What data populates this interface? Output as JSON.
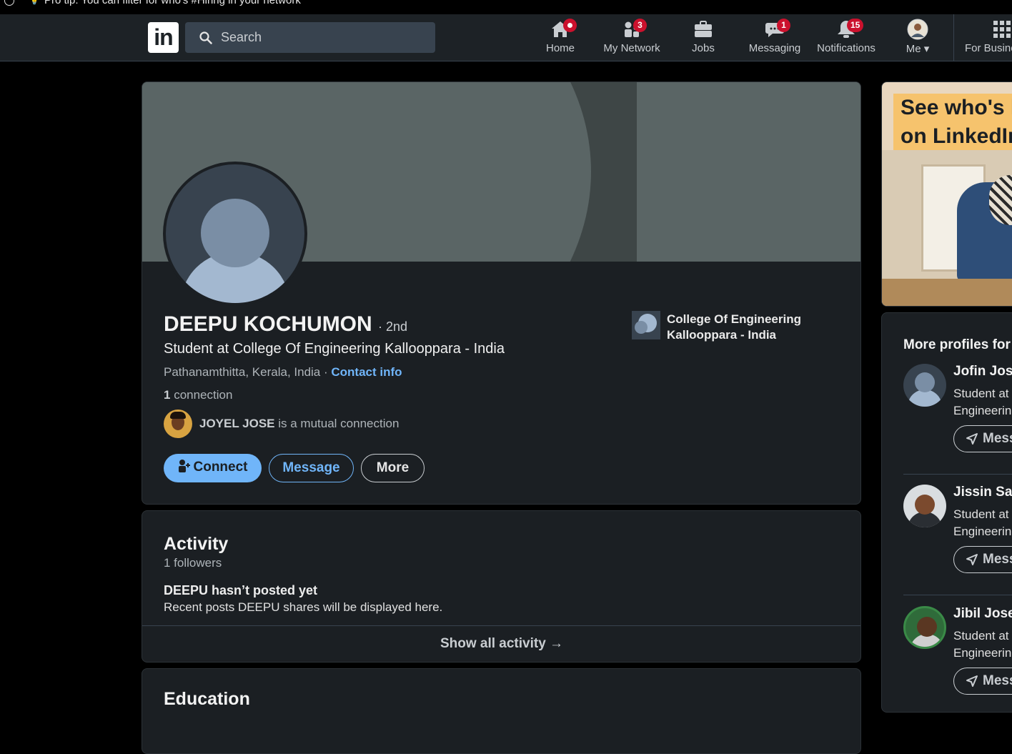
{
  "tip": {
    "text": "Pro tip: You can filter for who's #Hiring in your network"
  },
  "nav": {
    "logo": "in",
    "search_placeholder": "Search",
    "items": [
      {
        "label": "Home",
        "badge": ""
      },
      {
        "label": "My Network",
        "badge": "3"
      },
      {
        "label": "Jobs",
        "badge": ""
      },
      {
        "label": "Messaging",
        "badge": "1"
      },
      {
        "label": "Notifications",
        "badge": "15"
      },
      {
        "label": "Me ▾",
        "badge": ""
      },
      {
        "label": "For Busine",
        "badge": ""
      }
    ]
  },
  "profile": {
    "name": "DEEPU KOCHUMON",
    "degree": "· 2nd",
    "headline": "Student at College Of Engineering Kallooppara - India",
    "location": "Pathanamthitta, Kerala, India · ",
    "contact_info": "Contact info",
    "connections_count": "1",
    "connections_label": " connection",
    "mutual_name": "JOYEL JOSE",
    "mutual_suffix": " is a mutual connection",
    "school": "College Of Engineering Kallooppara - India",
    "buttons": {
      "connect": "Connect",
      "message": "Message",
      "more": "More"
    }
  },
  "activity": {
    "title": "Activity",
    "followers": "1 followers",
    "empty_title": "DEEPU hasn’t posted yet",
    "empty_desc": "Recent posts DEEPU shares will be displayed here.",
    "show_all": "Show all activity →"
  },
  "education": {
    "title": "Education"
  },
  "ad": {
    "line1": "See who's h",
    "line2": "on LinkedIn."
  },
  "sidebar": {
    "title": "More profiles for",
    "message_label": "Mess",
    "profiles": [
      {
        "name": "Jofin Jose",
        "line1": "Student at",
        "line2": "Engineerin"
      },
      {
        "name": "Jissin San",
        "line1": "Student at",
        "line2": "Engineerin"
      },
      {
        "name": "Jibil Josep",
        "line1": "Student at",
        "line2": "Engineerin"
      }
    ]
  },
  "colors": {
    "accent": "#70b5f9",
    "badge": "#cb112d",
    "nav_bg": "#1d2226",
    "card_bg": "#1b1f23"
  }
}
